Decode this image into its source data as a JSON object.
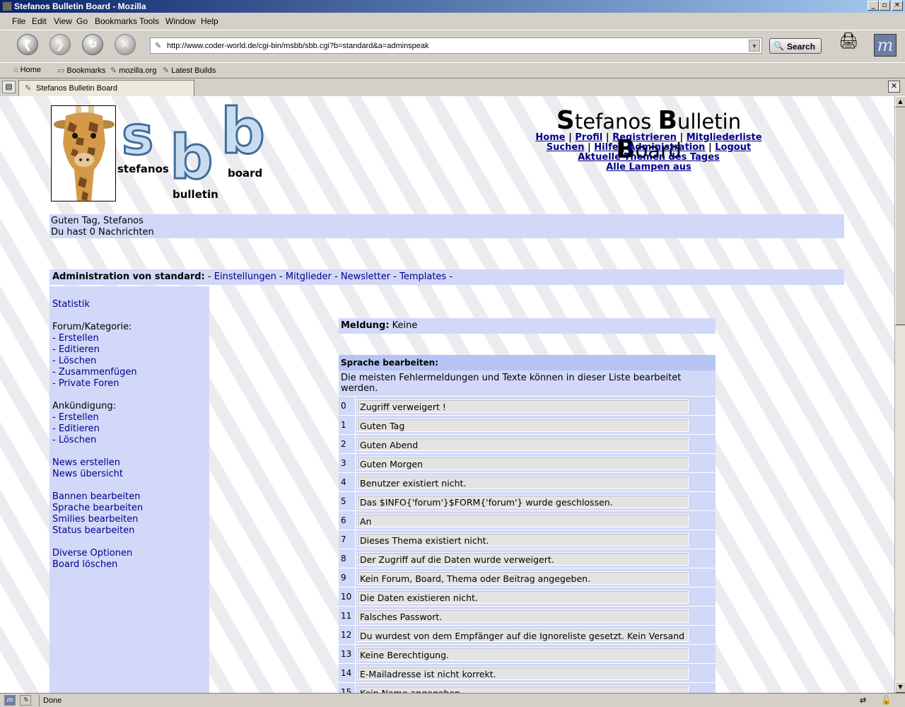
{
  "window": {
    "title": "Stefanos Bulletin Board - Mozilla",
    "controls": {
      "minimize": "_",
      "maximize": "▫",
      "close": "✕"
    }
  },
  "menu": {
    "items": [
      "File",
      "Edit",
      "View",
      "Go",
      "Bookmarks",
      "Tools",
      "Window",
      "Help"
    ]
  },
  "navbar": {
    "url": "http://www.coder-world.de/cgi-bin/msbb/sbb.cgi?b=standard&a=adminspeak",
    "search_label": "Search"
  },
  "personal_toolbar": {
    "items": [
      "Home",
      "Bookmarks",
      "mozilla.org",
      "Latest Builds"
    ]
  },
  "tabs": {
    "active_label": "Stefanos Bulletin Board"
  },
  "status": {
    "text": "Done"
  },
  "page": {
    "logo": {
      "letters": [
        "s",
        "b",
        "b"
      ],
      "words": [
        "stefanos",
        "bulletin",
        "board"
      ]
    },
    "title": {
      "parts": [
        {
          "cap": "S",
          "rest": "tefanos "
        },
        {
          "cap": "B",
          "rest": "ulletin "
        },
        {
          "cap": "B",
          "rest": "oard"
        }
      ]
    },
    "topnav": {
      "home": "Home",
      "profil": "Profil",
      "registrieren": "Registrieren",
      "mitgliederliste": "Mitgliederliste",
      "suchen": "Suchen",
      "hilfe": "Hilfe",
      "administration": "Administration",
      "logout": "Logout",
      "aktuelle": "Aktuelle Themen des Tages",
      "lampen": "Alle Lampen aus",
      "separator": "|"
    },
    "greeting": {
      "line1": "Guten Tag, Stefanos",
      "line2": "Du hast 0 Nachrichten"
    },
    "admin_bar": {
      "label": "Administration von standard:",
      "sep": "-",
      "links": [
        "Einstellungen",
        "Mitglieder",
        "Newsletter",
        "Templates"
      ]
    },
    "sidebar": {
      "statistik": "Statistik",
      "forum_heading": "Forum/Kategorie:",
      "forum_links": [
        "- Erstellen",
        "- Editieren",
        "- Löschen",
        "- Zusammenfügen",
        "- Private Foren"
      ],
      "ankuendigung_heading": "Ankündigung:",
      "ankuendigung_links": [
        "- Erstellen",
        "- Editieren",
        "- Löschen"
      ],
      "news_links": [
        "News erstellen",
        "News übersicht"
      ],
      "edit_links": [
        "Bannen bearbeiten",
        "Sprache bearbeiten",
        "Smilies bearbeiten",
        "Status bearbeiten"
      ],
      "misc_links": [
        "Diverse Optionen",
        "Board löschen"
      ]
    },
    "message": {
      "label": "Meldung:",
      "value": "Keine"
    },
    "language": {
      "heading": "Sprache bearbeiten:",
      "description": "Die meisten Fehlermeldungen und Texte können in dieser Liste bearbeitet werden.",
      "entries": [
        {
          "id": "0",
          "text": "Zugriff verweigert !"
        },
        {
          "id": "1",
          "text": "Guten Tag"
        },
        {
          "id": "2",
          "text": "Guten Abend"
        },
        {
          "id": "3",
          "text": "Guten Morgen"
        },
        {
          "id": "4",
          "text": "Benutzer existiert nicht."
        },
        {
          "id": "5",
          "text": "Das $INFO{'forum'}$FORM{'forum'} wurde geschlossen."
        },
        {
          "id": "6",
          "text": "An"
        },
        {
          "id": "7",
          "text": "Dieses Thema existiert nicht."
        },
        {
          "id": "8",
          "text": "Der Zugriff auf die Daten wurde verweigert."
        },
        {
          "id": "9",
          "text": "Kein Forum, Board, Thema oder Beitrag angegeben."
        },
        {
          "id": "10",
          "text": "Die Daten existieren nicht."
        },
        {
          "id": "11",
          "text": "Falsches Passwort."
        },
        {
          "id": "12",
          "text": "Du wurdest von dem Empfänger auf die Ignoreliste gesetzt. Kein Versand"
        },
        {
          "id": "13",
          "text": "Keine Berechtigung."
        },
        {
          "id": "14",
          "text": "E-Mailadresse ist nicht korrekt."
        },
        {
          "id": "15",
          "text": "Kein Name angegeben"
        }
      ]
    }
  }
}
